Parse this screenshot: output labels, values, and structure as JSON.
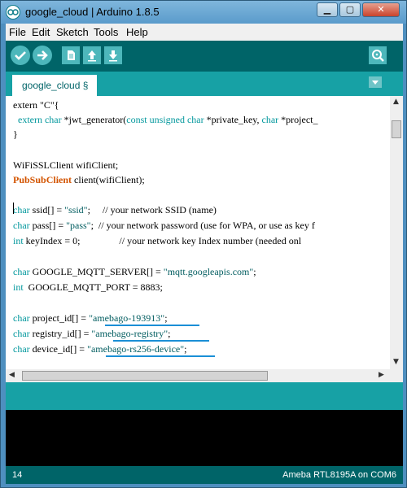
{
  "window": {
    "title": "google_cloud | Arduino 1.8.5",
    "controls": {
      "minimize": "▁",
      "maximize": "▢",
      "close": "✕"
    }
  },
  "menu": [
    {
      "label": "File"
    },
    {
      "label": "Edit"
    },
    {
      "label": "Sketch"
    },
    {
      "label": "Tools"
    },
    {
      "label": "Help"
    }
  ],
  "toolbar": {
    "buttons": [
      "verify-icon",
      "upload-icon",
      "new-icon",
      "open-icon",
      "save-icon",
      "serial-monitor-icon"
    ]
  },
  "tabs": [
    {
      "label": "google_cloud §"
    }
  ],
  "code": {
    "l1": "extern \"C\"{",
    "l2_kw": "extern",
    "l2_typ": "char",
    "l2_a": " *jwt_generator(",
    "l2_c1": "const",
    "l2_c2": "unsigned",
    "l2_c3": "char",
    "l2_b": " *private_key, ",
    "l2_c4": "char",
    "l2_d": " *project_",
    "l3": "}",
    "l4": "WiFiSSLClient wifiClient;",
    "l5_cls": "PubSubClient",
    "l5_rest": " client(wifiClient);",
    "l6_typ": "char",
    "l6_a": " ssid[] = ",
    "l6_str": "\"ssid\"",
    "l6_b": ";     // your network SSID (name)",
    "l7_typ": "char",
    "l7_a": " pass[] = ",
    "l7_str": "\"pass\"",
    "l7_b": ";  // your network password (use for WPA, or use as key f",
    "l8_typ": "int",
    "l8_a": " keyIndex = 0;                // your network key Index number (needed onl",
    "l9_typ": "char",
    "l9_a": " GOOGLE_MQTT_SERVER[] = ",
    "l9_str": "\"mqtt.googleapis.com\"",
    "l9_b": ";",
    "l10_typ": "int",
    "l10_a": "  GOOGLE_MQTT_PORT = 8883;",
    "l11_typ": "char",
    "l11_a": " project_id[] = ",
    "l11_str": "\"amebago-193913\"",
    "l11_b": ";",
    "l12_typ": "char",
    "l12_a": " registry_id[] = ",
    "l12_str": "\"amebago-registry\"",
    "l12_b": ";",
    "l13_typ": "char",
    "l13_a": " device_id[] = ",
    "l13_str": "\"amebago-rs256-device\"",
    "l13_b": ";"
  },
  "status": {
    "line_number": "14",
    "board": "Ameba RTL8195A on COM6"
  },
  "colors": {
    "toolbar": "#006468",
    "tabbar": "#17a1a5",
    "keyword": "#00979c",
    "class": "#d35400",
    "highlight_underline": "#1a8fd6"
  }
}
